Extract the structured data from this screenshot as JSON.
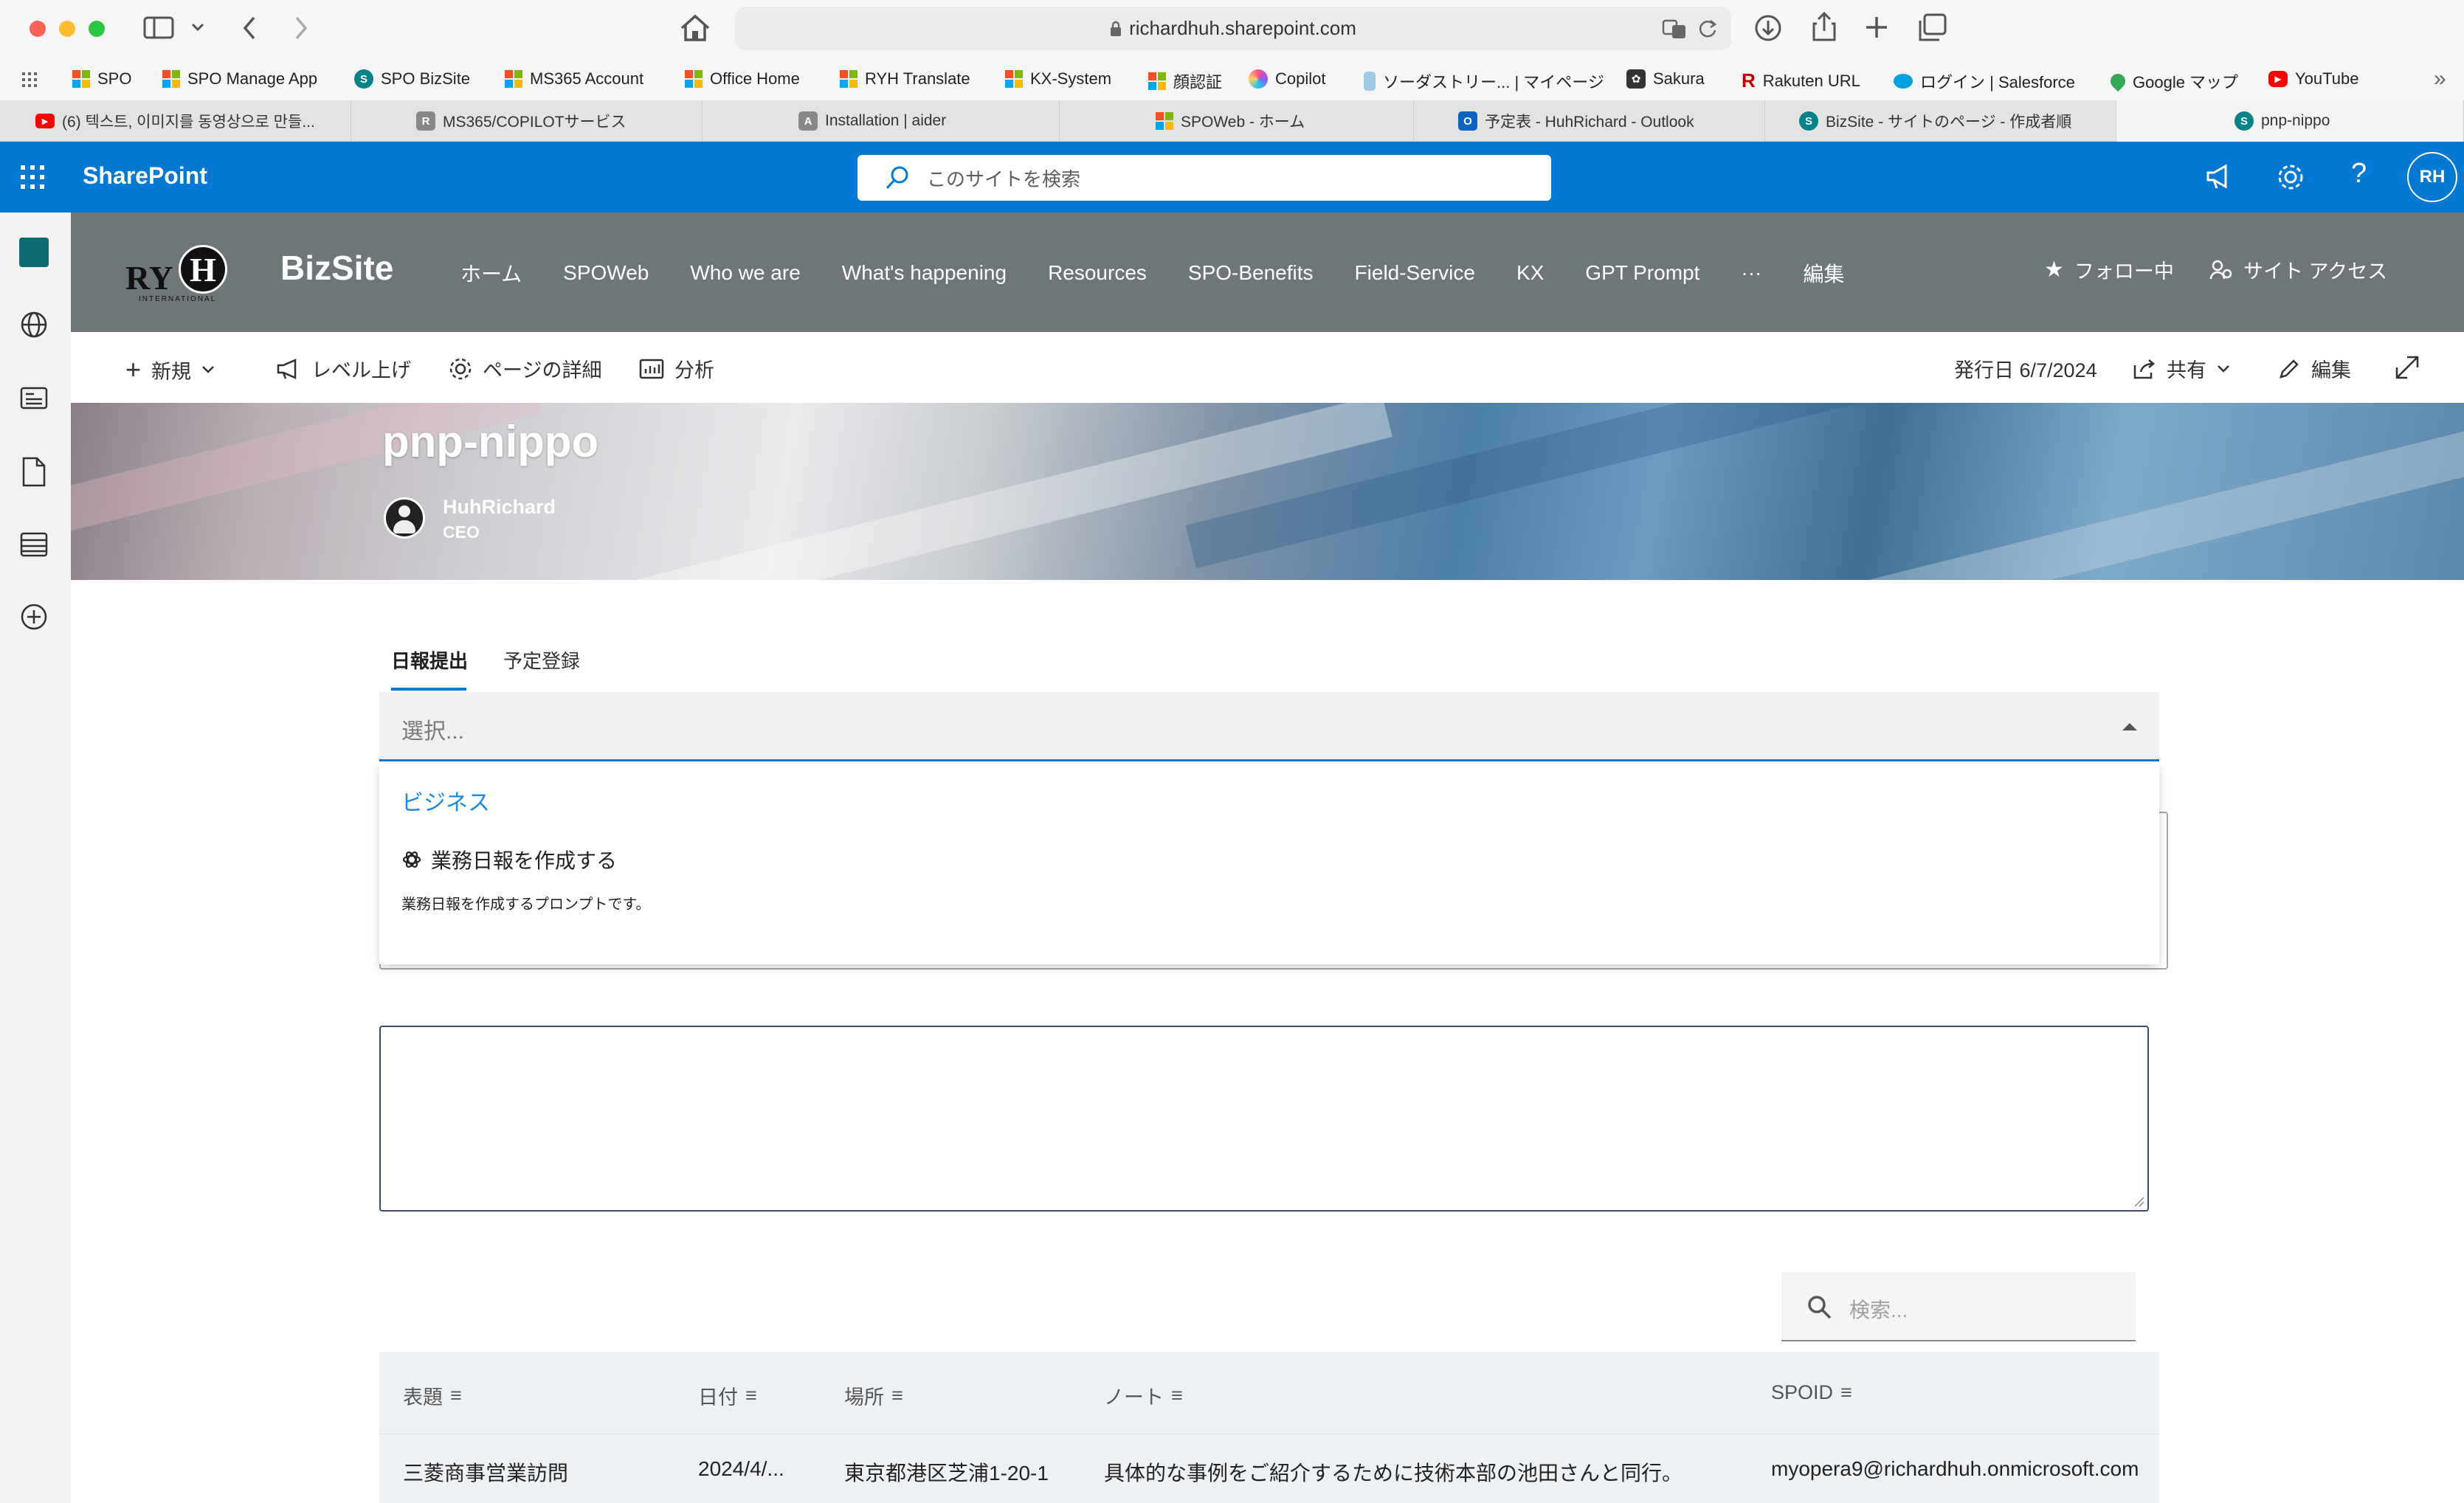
{
  "browser": {
    "url": "richardhuh.sharepoint.com"
  },
  "bookmarks": [
    "SPO",
    "SPO Manage App",
    "SPO BizSite",
    "MS365 Account",
    "Office Home",
    "RYH Translate",
    "KX-System",
    "顔認証",
    "Copilot",
    "ソーダストリー... | マイページ",
    "Sakura",
    "Rakuten URL",
    "ログイン | Salesforce",
    "Google マップ",
    "YouTube"
  ],
  "tabs": [
    "(6) 텍스트, 이미지를 동영상으로 만들...",
    "MS365/COPILOTサービス",
    "Installation | aider",
    "SPOWeb - ホーム",
    "予定表 - HuhRichard - Outlook",
    "BizSite - サイトのページ - 作成者順",
    "pnp-nippo"
  ],
  "suite": {
    "app": "SharePoint",
    "search_placeholder": "このサイトを検索",
    "avatar": "RH"
  },
  "site": {
    "logo_text": "RY",
    "logo_letter": "H",
    "logo_sub": "INTERNATIONAL",
    "name": "BizSite",
    "nav": [
      "ホーム",
      "SPOWeb",
      "Who we are",
      "What's happening",
      "Resources",
      "SPO-Benefits",
      "Field-Service",
      "KX",
      "GPT Prompt",
      "···",
      "編集"
    ],
    "follow": "フォロー中",
    "access": "サイト アクセス"
  },
  "cmdbar": {
    "new": "新規",
    "promote": "レベル上げ",
    "details": "ページの詳細",
    "analytics": "分析",
    "published": "発行日 6/7/2024",
    "share": "共有",
    "edit": "編集"
  },
  "page": {
    "title": "pnp-nippo",
    "author": "HuhRichard",
    "role": "CEO"
  },
  "form": {
    "tabs": [
      "日報提出",
      "予定登録"
    ],
    "select_placeholder": "選択...",
    "group": "ビジネス",
    "option_title": "業務日報を作成する",
    "option_desc": "業務日報を作成するプロンプトです。"
  },
  "list": {
    "search_placeholder": "検索...",
    "columns": [
      "表題",
      "日付",
      "場所",
      "ノート",
      "SPOID"
    ],
    "rows": [
      [
        "三菱商事営業訪問",
        "2024/4/...",
        "東京都港区芝浦1-20-1",
        "具体的な事例をご紹介するために技術本部の池田さんと同行。",
        "myopera9@richardhuh.onmicrosoft.com"
      ]
    ]
  },
  "colors": {
    "suite": "#0078d4",
    "accent": "#0078d4",
    "header": "#6e7679"
  }
}
